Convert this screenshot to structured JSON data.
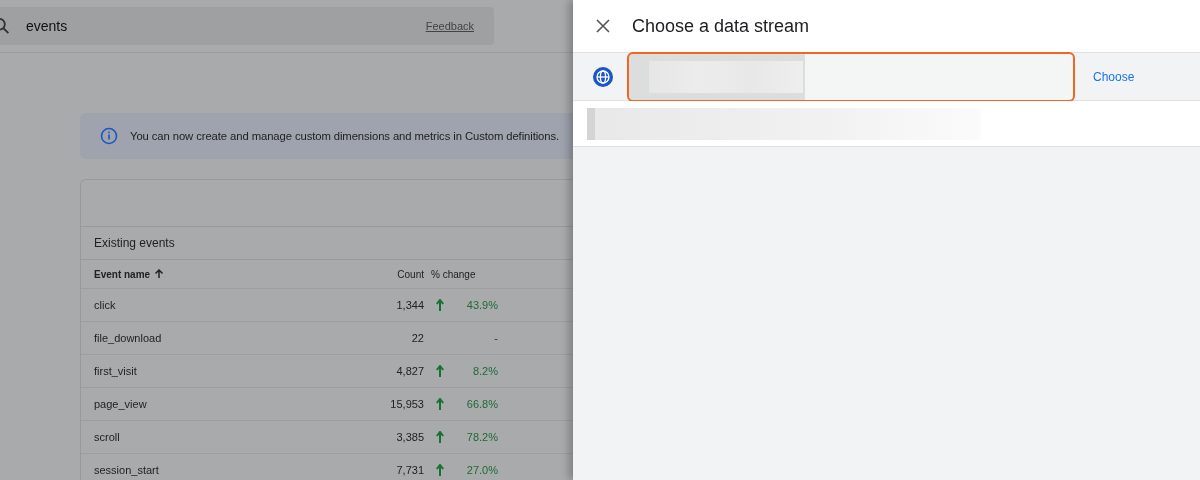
{
  "search": {
    "value": "events",
    "feedback": "Feedback"
  },
  "banner": {
    "text": "You can now create and manage custom dimensions and metrics in Custom definitions."
  },
  "table": {
    "title": "Existing events",
    "columns": [
      {
        "label": "Event name",
        "sorted": true
      },
      {
        "label": "Count",
        "sorted": false
      },
      {
        "label": "% change",
        "sorted": false
      }
    ],
    "rows": [
      {
        "name": "click",
        "count": "1,344",
        "rising": true,
        "change": "43.9%"
      },
      {
        "name": "file_download",
        "count": "22",
        "rising": false,
        "change": "-"
      },
      {
        "name": "first_visit",
        "count": "4,827",
        "rising": true,
        "change": "8.2%"
      },
      {
        "name": "page_view",
        "count": "15,953",
        "rising": true,
        "change": "66.8%"
      },
      {
        "name": "scroll",
        "count": "3,385",
        "rising": true,
        "change": "78.2%"
      },
      {
        "name": "session_start",
        "count": "7,731",
        "rising": true,
        "change": "27.0%"
      }
    ]
  },
  "panel": {
    "title": "Choose a data stream",
    "streams": [
      {
        "kind": "web",
        "action": "Choose",
        "highlighted": true
      },
      {
        "kind": "hidden",
        "highlighted": false
      }
    ]
  }
}
